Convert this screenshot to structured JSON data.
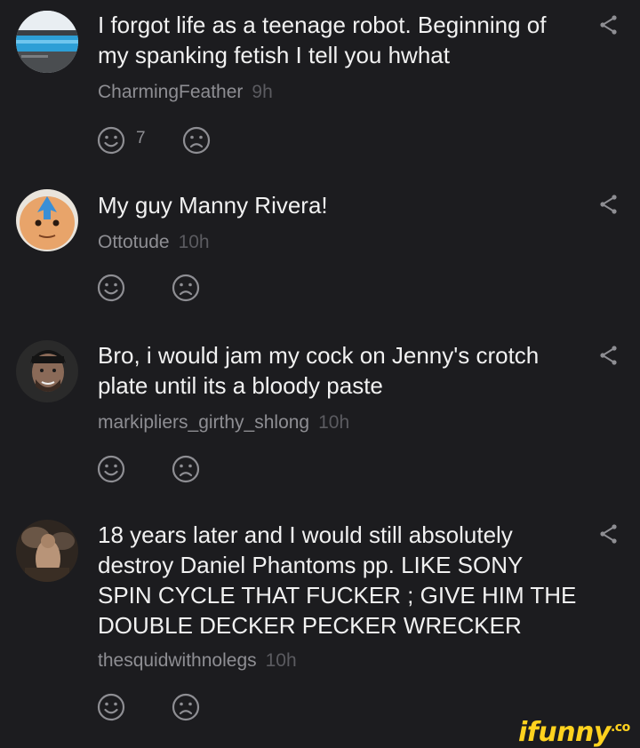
{
  "colors": {
    "background": "#1c1c1f",
    "text": "#f1f1f1",
    "username": "#8e8e93",
    "timestamp": "#5b5b60",
    "icon": "#8e8e93",
    "watermark": "#ffd21e"
  },
  "comments": [
    {
      "text": "I forgot life as a teenage robot. Beginning of my spanking fetish I tell you hwhat",
      "username": "CharmingFeather",
      "time": "9h",
      "smile_count": "7",
      "avatar_icon": "pool-photo-avatar"
    },
    {
      "text": "My guy Manny Rivera!",
      "username": "Ottotude",
      "time": "10h",
      "smile_count": "",
      "avatar_icon": "cartoon-face-avatar"
    },
    {
      "text": "Bro, i would jam my cock on Jenny's crotch plate until its a bloody paste",
      "username": "markipliers_girthy_shlong",
      "time": "10h",
      "smile_count": "",
      "avatar_icon": "person-photo-avatar"
    },
    {
      "text": "18 years later and I would still absolutely destroy Daniel Phantoms pp. LIKE SONY SPIN CYCLE THAT FUCKER ; GIVE HIM THE DOUBLE DECKER PECKER WRECKER",
      "username": "thesquidwithnolegs",
      "time": "10h",
      "smile_count": "",
      "avatar_icon": "painting-avatar"
    }
  ],
  "watermark": {
    "text": "ifunny",
    "suffix": ".co"
  }
}
